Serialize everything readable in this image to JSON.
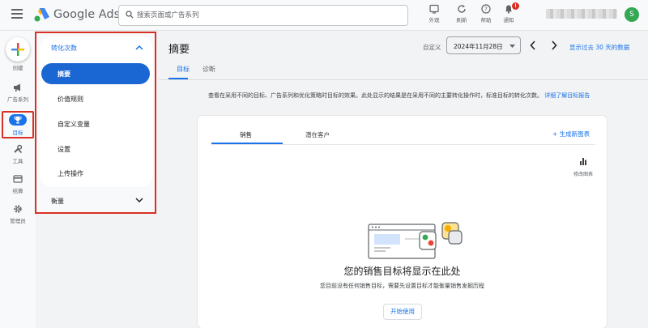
{
  "topbar": {
    "brand": "Google Ads",
    "search_placeholder": "搜索页面或广告系列",
    "actions": [
      {
        "label": "外观",
        "icon": "appearance-icon"
      },
      {
        "label": "刷新",
        "icon": "refresh-icon"
      },
      {
        "label": "帮助",
        "icon": "help-icon"
      },
      {
        "label": "通知",
        "icon": "bell-icon",
        "badge": "!"
      }
    ],
    "avatar_initial": "S"
  },
  "rail": {
    "create_label": "创建",
    "items": [
      {
        "label": "广告系列",
        "icon": "megaphone-icon"
      },
      {
        "label": "目标",
        "icon": "trophy-icon",
        "active": true
      },
      {
        "label": "工具",
        "icon": "tools-icon"
      },
      {
        "label": "结算",
        "icon": "billing-icon"
      },
      {
        "label": "管理员",
        "icon": "admin-gear-icon"
      }
    ]
  },
  "subnav": {
    "group_label": "转化次数",
    "items": [
      "摘要",
      "价值规则",
      "自定义变量",
      "设置",
      "上传操作"
    ],
    "selected_index": 0,
    "collapsed_label": "衡量"
  },
  "main": {
    "title": "摘要",
    "date_custom_label": "自定义",
    "date_value": "2024年11月28日",
    "show_data_label": "显示过去 30 天的数据",
    "tabs": [
      "目标",
      "诊断"
    ],
    "description": "查看在采用不同的目标、广告系列和优化策略时目标的效果。此处显示的结果是在采用不同的主要转化操作时，标准目标的转化次数。",
    "learn_more": "详细了解目标报告",
    "card": {
      "tabs": [
        "销售",
        "潜在客户"
      ],
      "new_chart": "生成新图表",
      "edit_chart": "修改图表",
      "empty_title": "您的销售目标将显示在此处",
      "empty_subtitle": "您目前没有任何销售目标，需要先设置目标才能衡量销售发掘历程",
      "start_button": "开始使用"
    }
  },
  "colors": {
    "accent": "#1a73e8",
    "highlight_border": "#d93025"
  }
}
